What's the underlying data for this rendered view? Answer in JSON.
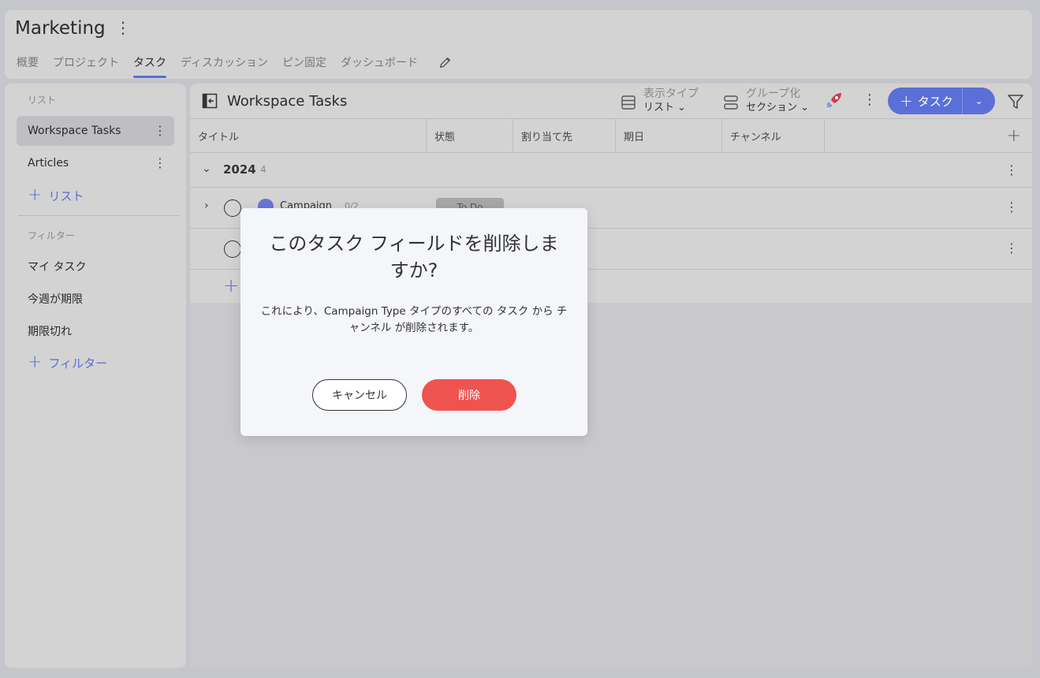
{
  "workspace": {
    "title": "Marketing"
  },
  "tabs": [
    {
      "label": "概要"
    },
    {
      "label": "プロジェクト"
    },
    {
      "label": "タスク"
    },
    {
      "label": "ディスカッション"
    },
    {
      "label": "ピン固定"
    },
    {
      "label": "ダッシュボード"
    }
  ],
  "sidebar": {
    "lists_heading": "リスト",
    "lists": [
      {
        "label": "Workspace Tasks"
      },
      {
        "label": "Articles"
      }
    ],
    "add_list_label": "リスト",
    "filters_heading": "フィルター",
    "filters": [
      {
        "label": "マイ タスク"
      },
      {
        "label": "今週が期限"
      },
      {
        "label": "期限切れ"
      }
    ],
    "add_filter_label": "フィルター"
  },
  "main": {
    "title": "Workspace Tasks",
    "view_type_label": "表示タイプ",
    "view_type_value": "リスト",
    "group_by_label": "グループ化",
    "group_by_value": "セクション",
    "add_task_label": "タスク",
    "columns": [
      "タイトル",
      "状態",
      "割り当て先",
      "期日",
      "チャンネル"
    ],
    "group": {
      "name": "2024",
      "count": "4"
    },
    "task": {
      "name": "Campaign",
      "subtasks": "0/2",
      "status": "To Do"
    }
  },
  "dialog": {
    "title": "このタスク フィールドを削除しますか?",
    "body": "これにより、Campaign Type タイプのすべての タスク から チャンネル が削除されます。",
    "cancel_label": "キャンセル",
    "delete_label": "削除"
  },
  "colors": {
    "accent": "#5a6fd8",
    "danger": "#ef5350"
  }
}
